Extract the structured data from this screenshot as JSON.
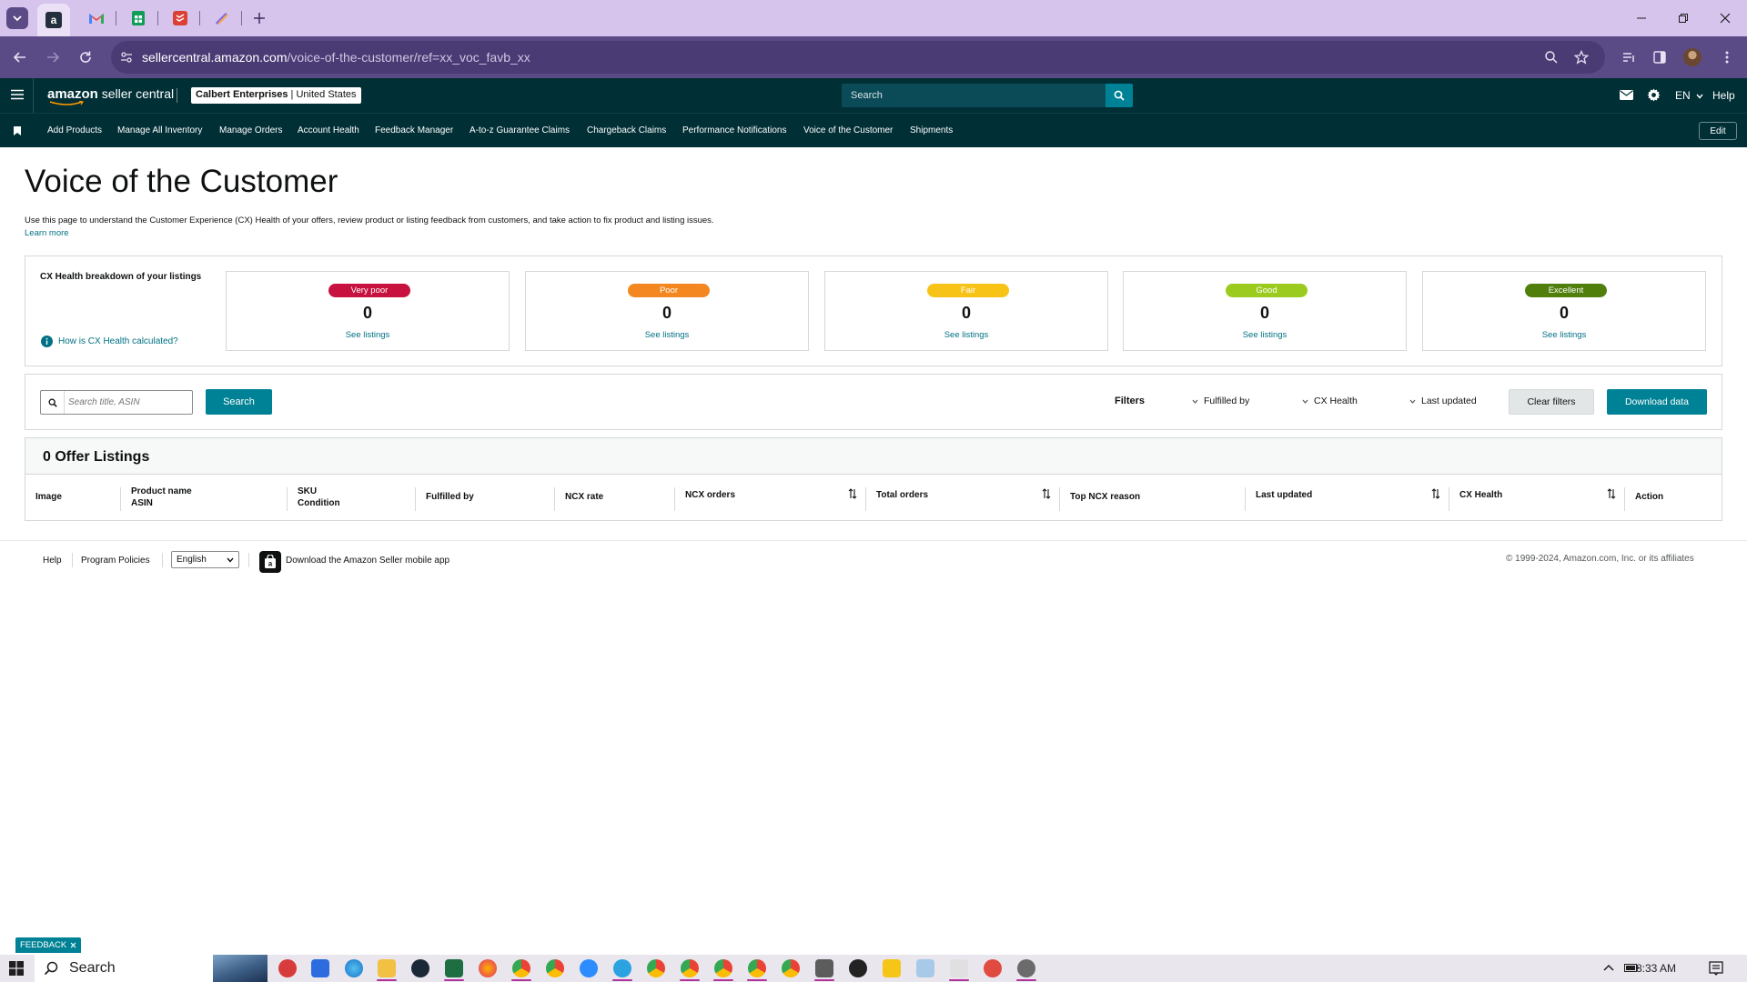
{
  "browser": {
    "url_host": "sellercentral.amazon.com",
    "url_path": "/voice-of-the-customer/ref=xx_voc_favb_xx"
  },
  "header": {
    "logo_brand": "amazon",
    "logo_product": "seller central",
    "account_name": "Calbert Enterprises",
    "account_region": "United States",
    "search_placeholder": "Search",
    "language": "EN",
    "help": "Help"
  },
  "nav": {
    "items": [
      "Add Products",
      "Manage All Inventory",
      "Manage Orders",
      "Account Health",
      "Feedback Manager",
      "A-to-z Guarantee Claims",
      "Chargeback Claims",
      "Performance Notifications",
      "Voice of the Customer",
      "Shipments"
    ],
    "edit": "Edit"
  },
  "page": {
    "title": "Voice of the Customer",
    "description": "Use this page to understand the Customer Experience (CX) Health of your offers, review product or listing feedback from customers, and take action to fix product and listing issues.",
    "learn_more": "Learn more"
  },
  "cx_health": {
    "label": "CX Health breakdown of your listings",
    "how_link": "How is CX Health calculated?",
    "tiles": [
      {
        "label": "Very poor",
        "count": "0",
        "link": "See listings",
        "color": "#c7113e"
      },
      {
        "label": "Poor",
        "count": "0",
        "link": "See listings",
        "color": "#f4871f"
      },
      {
        "label": "Fair",
        "count": "0",
        "link": "See listings",
        "color": "#f8c317"
      },
      {
        "label": "Good",
        "count": "0",
        "link": "See listings",
        "color": "#9ccb1f"
      },
      {
        "label": "Excellent",
        "count": "0",
        "link": "See listings",
        "color": "#507f0c"
      }
    ]
  },
  "filters": {
    "search_placeholder": "Search title, ASIN",
    "search_button": "Search",
    "filters_label": "Filters",
    "dropdowns": [
      "Fulfilled by",
      "CX Health",
      "Last updated"
    ],
    "clear": "Clear filters",
    "download": "Download data"
  },
  "table": {
    "title": "0 Offer Listings",
    "columns": [
      {
        "line1": "Image",
        "line2": ""
      },
      {
        "line1": "Product name",
        "line2": "ASIN"
      },
      {
        "line1": "SKU",
        "line2": "Condition"
      },
      {
        "line1": "Fulfilled by",
        "line2": ""
      },
      {
        "line1": "NCX rate",
        "line2": ""
      },
      {
        "line1": "NCX orders",
        "line2": ""
      },
      {
        "line1": "Total orders",
        "line2": ""
      },
      {
        "line1": "Top NCX reason",
        "line2": ""
      },
      {
        "line1": "Last updated",
        "line2": ""
      },
      {
        "line1": "CX Health",
        "line2": ""
      },
      {
        "line1": "Action",
        "line2": ""
      }
    ]
  },
  "footer": {
    "help": "Help",
    "policies": "Program Policies",
    "language": "English",
    "app_link": "Download the Amazon Seller mobile app",
    "copyright": "© 1999-2024, Amazon.com, Inc. or its affiliates"
  },
  "feedback_tab": "FEEDBACK",
  "taskbar": {
    "search": "Search",
    "time": "8:33 AM"
  },
  "colors": {
    "header_bg": "#002f36",
    "accent": "#008296",
    "link": "#007185",
    "browser_frame": "#5a4a86"
  }
}
